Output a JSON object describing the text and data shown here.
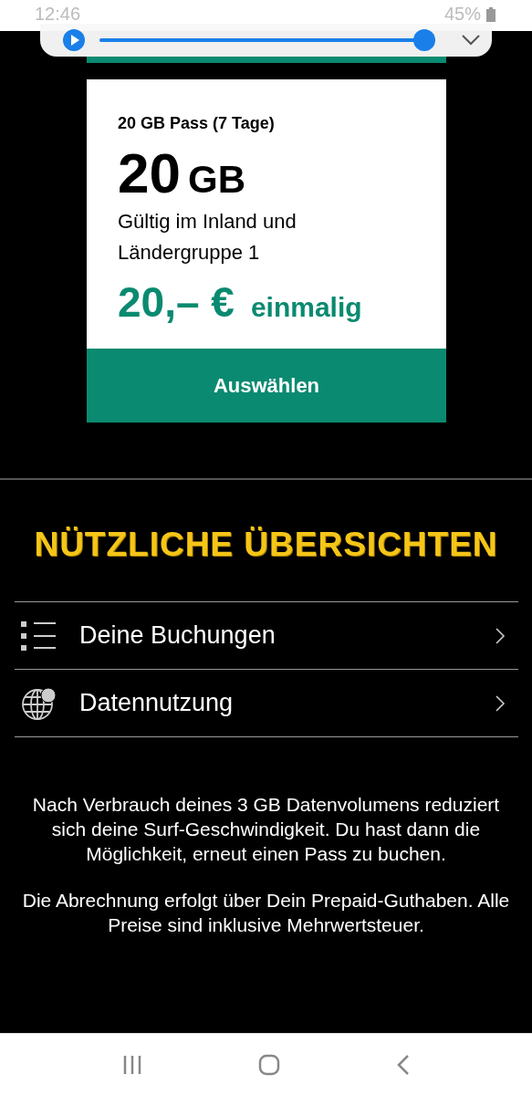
{
  "status_bar": {
    "time": "12:46",
    "battery": "45%"
  },
  "media_player": {
    "level": 1.0
  },
  "pass_card": {
    "title": "20 GB Pass (7 Tage)",
    "amount": "20",
    "unit": "GB",
    "description": "Gültig im Inland und Ländergruppe 1",
    "price": "20,– €",
    "price_note": "einmalig",
    "button": "Auswählen"
  },
  "overview": {
    "heading": "NÜTZLICHE ÜBERSICHTEN",
    "items": [
      {
        "kind": "list",
        "label": "Deine Buchungen"
      },
      {
        "kind": "globe",
        "label": "Datennutzung"
      }
    ]
  },
  "notes": [
    "Nach Verbrauch deines 3 GB Datenvolumens reduziert sich deine Surf-Geschwindigkeit. Du hast dann die Möglichkeit, erneut einen Pass zu buchen.",
    "Die Abrechnung erfolgt über Dein Prepaid-Guthaben. Alle Preise sind inklusive Mehrwertsteuer."
  ]
}
